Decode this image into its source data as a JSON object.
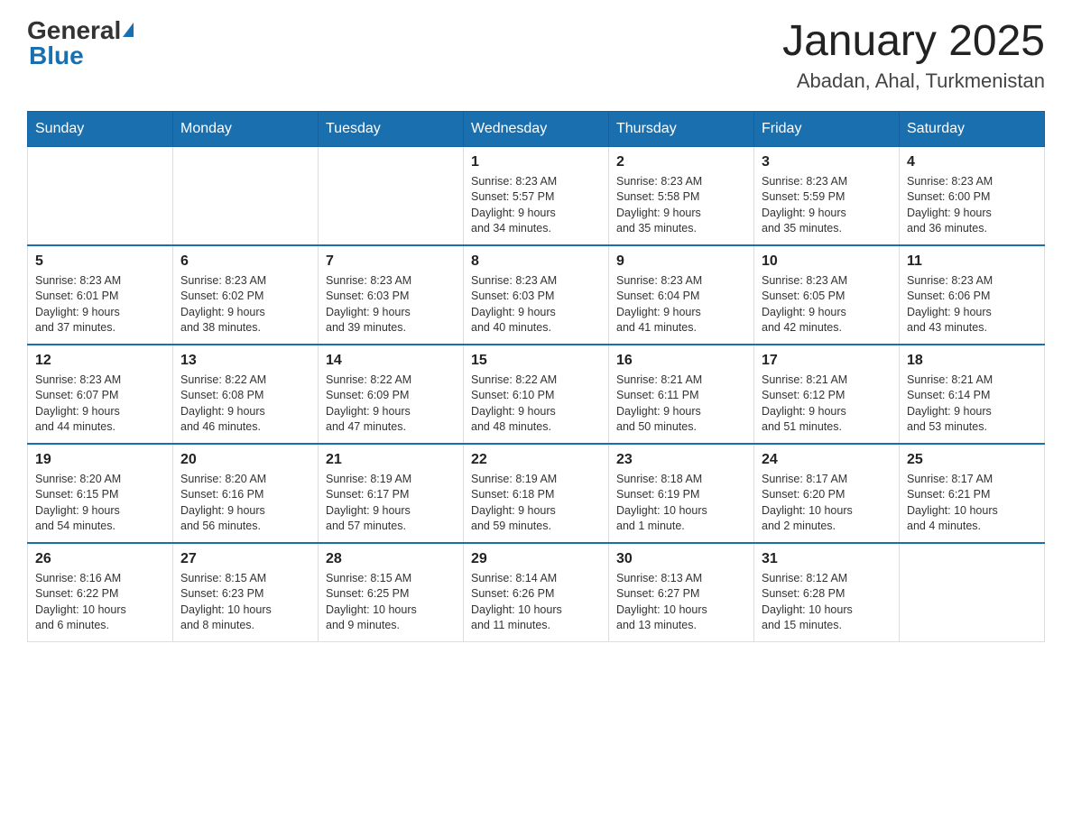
{
  "header": {
    "logo_general": "General",
    "logo_blue": "Blue",
    "month_title": "January 2025",
    "location": "Abadan, Ahal, Turkmenistan"
  },
  "days_of_week": [
    "Sunday",
    "Monday",
    "Tuesday",
    "Wednesday",
    "Thursday",
    "Friday",
    "Saturday"
  ],
  "weeks": [
    {
      "days": [
        {
          "number": "",
          "info": ""
        },
        {
          "number": "",
          "info": ""
        },
        {
          "number": "",
          "info": ""
        },
        {
          "number": "1",
          "info": "Sunrise: 8:23 AM\nSunset: 5:57 PM\nDaylight: 9 hours\nand 34 minutes."
        },
        {
          "number": "2",
          "info": "Sunrise: 8:23 AM\nSunset: 5:58 PM\nDaylight: 9 hours\nand 35 minutes."
        },
        {
          "number": "3",
          "info": "Sunrise: 8:23 AM\nSunset: 5:59 PM\nDaylight: 9 hours\nand 35 minutes."
        },
        {
          "number": "4",
          "info": "Sunrise: 8:23 AM\nSunset: 6:00 PM\nDaylight: 9 hours\nand 36 minutes."
        }
      ]
    },
    {
      "days": [
        {
          "number": "5",
          "info": "Sunrise: 8:23 AM\nSunset: 6:01 PM\nDaylight: 9 hours\nand 37 minutes."
        },
        {
          "number": "6",
          "info": "Sunrise: 8:23 AM\nSunset: 6:02 PM\nDaylight: 9 hours\nand 38 minutes."
        },
        {
          "number": "7",
          "info": "Sunrise: 8:23 AM\nSunset: 6:03 PM\nDaylight: 9 hours\nand 39 minutes."
        },
        {
          "number": "8",
          "info": "Sunrise: 8:23 AM\nSunset: 6:03 PM\nDaylight: 9 hours\nand 40 minutes."
        },
        {
          "number": "9",
          "info": "Sunrise: 8:23 AM\nSunset: 6:04 PM\nDaylight: 9 hours\nand 41 minutes."
        },
        {
          "number": "10",
          "info": "Sunrise: 8:23 AM\nSunset: 6:05 PM\nDaylight: 9 hours\nand 42 minutes."
        },
        {
          "number": "11",
          "info": "Sunrise: 8:23 AM\nSunset: 6:06 PM\nDaylight: 9 hours\nand 43 minutes."
        }
      ]
    },
    {
      "days": [
        {
          "number": "12",
          "info": "Sunrise: 8:23 AM\nSunset: 6:07 PM\nDaylight: 9 hours\nand 44 minutes."
        },
        {
          "number": "13",
          "info": "Sunrise: 8:22 AM\nSunset: 6:08 PM\nDaylight: 9 hours\nand 46 minutes."
        },
        {
          "number": "14",
          "info": "Sunrise: 8:22 AM\nSunset: 6:09 PM\nDaylight: 9 hours\nand 47 minutes."
        },
        {
          "number": "15",
          "info": "Sunrise: 8:22 AM\nSunset: 6:10 PM\nDaylight: 9 hours\nand 48 minutes."
        },
        {
          "number": "16",
          "info": "Sunrise: 8:21 AM\nSunset: 6:11 PM\nDaylight: 9 hours\nand 50 minutes."
        },
        {
          "number": "17",
          "info": "Sunrise: 8:21 AM\nSunset: 6:12 PM\nDaylight: 9 hours\nand 51 minutes."
        },
        {
          "number": "18",
          "info": "Sunrise: 8:21 AM\nSunset: 6:14 PM\nDaylight: 9 hours\nand 53 minutes."
        }
      ]
    },
    {
      "days": [
        {
          "number": "19",
          "info": "Sunrise: 8:20 AM\nSunset: 6:15 PM\nDaylight: 9 hours\nand 54 minutes."
        },
        {
          "number": "20",
          "info": "Sunrise: 8:20 AM\nSunset: 6:16 PM\nDaylight: 9 hours\nand 56 minutes."
        },
        {
          "number": "21",
          "info": "Sunrise: 8:19 AM\nSunset: 6:17 PM\nDaylight: 9 hours\nand 57 minutes."
        },
        {
          "number": "22",
          "info": "Sunrise: 8:19 AM\nSunset: 6:18 PM\nDaylight: 9 hours\nand 59 minutes."
        },
        {
          "number": "23",
          "info": "Sunrise: 8:18 AM\nSunset: 6:19 PM\nDaylight: 10 hours\nand 1 minute."
        },
        {
          "number": "24",
          "info": "Sunrise: 8:17 AM\nSunset: 6:20 PM\nDaylight: 10 hours\nand 2 minutes."
        },
        {
          "number": "25",
          "info": "Sunrise: 8:17 AM\nSunset: 6:21 PM\nDaylight: 10 hours\nand 4 minutes."
        }
      ]
    },
    {
      "days": [
        {
          "number": "26",
          "info": "Sunrise: 8:16 AM\nSunset: 6:22 PM\nDaylight: 10 hours\nand 6 minutes."
        },
        {
          "number": "27",
          "info": "Sunrise: 8:15 AM\nSunset: 6:23 PM\nDaylight: 10 hours\nand 8 minutes."
        },
        {
          "number": "28",
          "info": "Sunrise: 8:15 AM\nSunset: 6:25 PM\nDaylight: 10 hours\nand 9 minutes."
        },
        {
          "number": "29",
          "info": "Sunrise: 8:14 AM\nSunset: 6:26 PM\nDaylight: 10 hours\nand 11 minutes."
        },
        {
          "number": "30",
          "info": "Sunrise: 8:13 AM\nSunset: 6:27 PM\nDaylight: 10 hours\nand 13 minutes."
        },
        {
          "number": "31",
          "info": "Sunrise: 8:12 AM\nSunset: 6:28 PM\nDaylight: 10 hours\nand 15 minutes."
        },
        {
          "number": "",
          "info": ""
        }
      ]
    }
  ]
}
